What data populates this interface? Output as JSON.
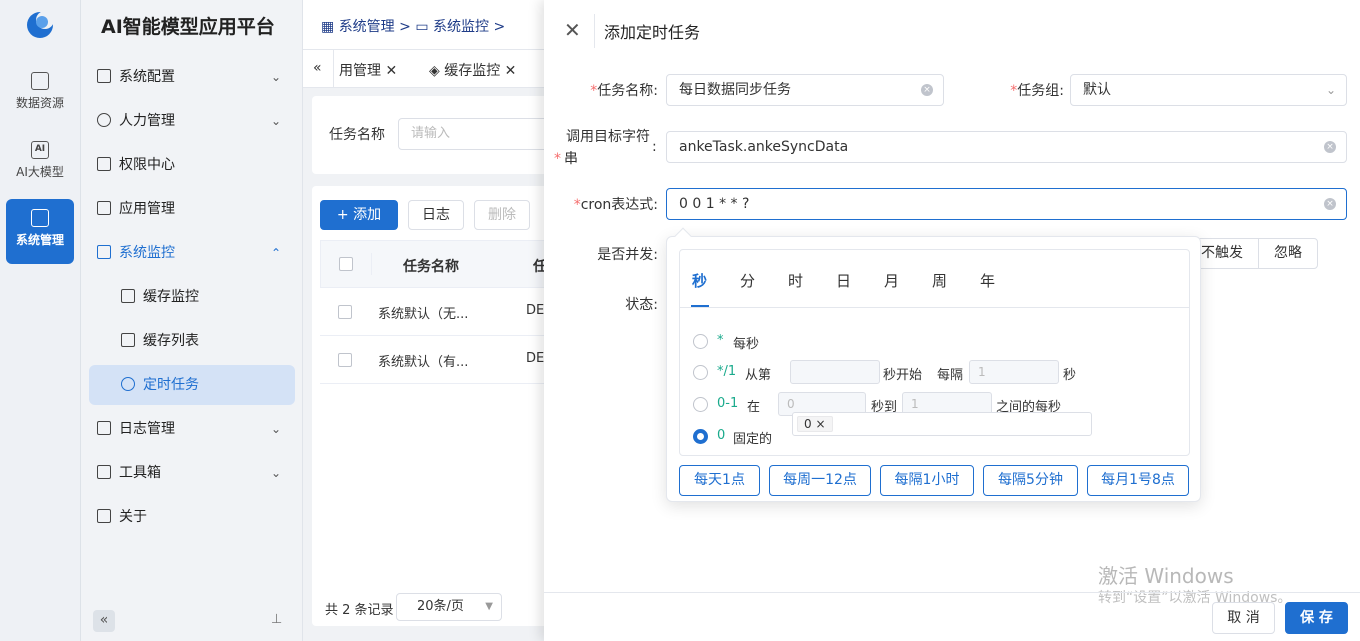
{
  "app": {
    "title": "AI智能模型应用平台"
  },
  "rail": {
    "items": [
      {
        "label": "数据资源",
        "icon": "database-icon"
      },
      {
        "label": "AI大模型",
        "icon": "ai-icon",
        "glyph": "AI"
      },
      {
        "label": "系统管理",
        "icon": "system-icon",
        "active": true
      }
    ]
  },
  "menu": {
    "items": [
      {
        "label": "系统配置"
      },
      {
        "label": "人力管理"
      },
      {
        "label": "权限中心"
      },
      {
        "label": "应用管理"
      },
      {
        "label": "系统监控"
      },
      {
        "label": "缓存监控"
      },
      {
        "label": "缓存列表"
      },
      {
        "label": "定时任务"
      },
      {
        "label": "日志管理"
      },
      {
        "label": "工具箱"
      },
      {
        "label": "关于"
      }
    ]
  },
  "breadcrumb": {
    "items": [
      "系统管理",
      "系统监控"
    ],
    "sep": ">"
  },
  "tabs": {
    "items": [
      "用管理",
      "缓存监控"
    ],
    "nav_left": "«"
  },
  "search": {
    "label": "任务名称",
    "placeholder": "请输入"
  },
  "toolbar": {
    "add_label": "+ 添加",
    "log_label": "日志",
    "delete_label": "删除"
  },
  "table": {
    "headers": [
      "任务名称",
      "任"
    ],
    "rows": [
      {
        "name": "系统默认（无...",
        "group": "DE"
      },
      {
        "name": "系统默认（有...",
        "group": "DE"
      }
    ],
    "total_text": "共 2 条记录",
    "page_size": "20条/页"
  },
  "drawer": {
    "title": "添加定时任务",
    "fields": {
      "task_name": {
        "label": "任务名称:",
        "value": "每日数据同步任务"
      },
      "task_group": {
        "label": "任务组:",
        "value": "默认"
      },
      "invoke_target": {
        "label_line1": "调用目标字符",
        "label_line2": "串",
        "colon": ":",
        "value": "ankeTask.ankeSyncData"
      },
      "cron": {
        "label": "cron表达式:",
        "value": "0 0 1 * * ?"
      },
      "concurrent": {
        "label": "是否并发:"
      },
      "status": {
        "label": "状态:"
      },
      "misfire": {
        "options": [
          "不触发",
          "忽略"
        ]
      }
    },
    "required_mark": "*",
    "cancel_label": "取 消",
    "save_label": "保 存"
  },
  "cron_popup": {
    "tabs": [
      "秒",
      "分",
      "时",
      "日",
      "月",
      "周",
      "年"
    ],
    "active_tab": "秒",
    "options": [
      {
        "code": "*",
        "text": "每秒"
      },
      {
        "code": "*/1",
        "text1": "从第",
        "input1": "",
        "text2": "秒开始",
        "text3": "每隔",
        "input2": "1",
        "text4": "秒"
      },
      {
        "code": "0-1",
        "text1": "在",
        "input1": "0",
        "text2": "秒到",
        "input2": "1",
        "text3": "之间的每秒"
      },
      {
        "code": "0",
        "text": "固定的",
        "tag": "0",
        "tag_close": "×"
      }
    ],
    "quick_buttons": [
      "每天1点",
      "每周一12点",
      "每隔1小时",
      "每隔5分钟",
      "每月1号8点"
    ]
  },
  "watermark": {
    "line1": "激活 Windows",
    "line2": "转到“设置”以激活 Windows。"
  },
  "colors": {
    "primary": "#1f6fd0",
    "required": "#f56c6c",
    "cron_code": "#1aaa8c"
  }
}
